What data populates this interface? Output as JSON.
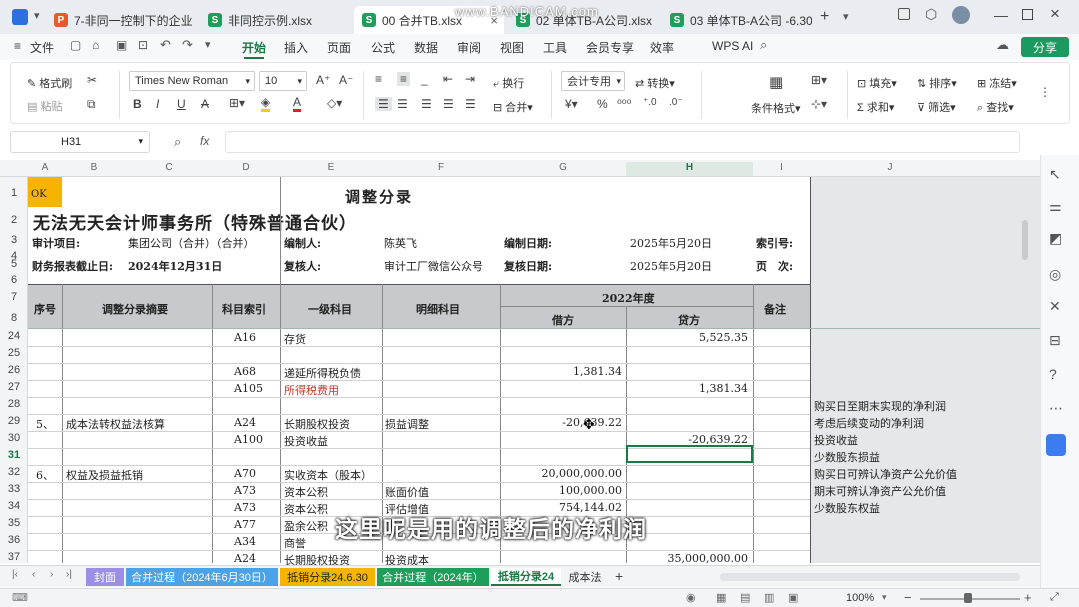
{
  "window": {
    "watermark": "www.BANDICAM.com"
  },
  "tabs": [
    {
      "label": "7-非同一控制下的企业"
    },
    {
      "label": "非同控示例.xlsx"
    },
    {
      "label": "00 合并TB.xlsx"
    },
    {
      "label": "02 单体TB-A公司.xlsx"
    },
    {
      "label": "03 单体TB-A公司 -6.30"
    }
  ],
  "menu": {
    "file": "文件",
    "items": [
      "开始",
      "插入",
      "页面",
      "公式",
      "数据",
      "审阅",
      "视图",
      "工具",
      "会员专享",
      "效率",
      "WPS AI"
    ],
    "share": "分享"
  },
  "ribbon": {
    "format_painter": "格式刷",
    "paste": "粘贴",
    "font": "Times New Roman",
    "size": "10",
    "wrap": "换行",
    "merge": "合并",
    "num_format": "会计专用",
    "convert": "转换",
    "cond_format": "条件格式",
    "fill": "填充",
    "sort": "排序",
    "freeze": "冻结",
    "sum": "求和",
    "filter": "筛选",
    "find": "查找"
  },
  "formula_bar": {
    "cell_ref": "H31",
    "fx": "fx"
  },
  "columns": [
    "A",
    "B",
    "C",
    "D",
    "E",
    "F",
    "G",
    "H",
    "I",
    "J"
  ],
  "rows": [
    "1",
    "2",
    "3",
    "4",
    "5",
    "6",
    "7",
    "8",
    "24",
    "25",
    "26",
    "27",
    "28",
    "29",
    "30",
    "31",
    "32",
    "33",
    "34",
    "35",
    "36",
    "37"
  ],
  "sheet": {
    "a1": "OK",
    "title": "调整分录",
    "firm": "无法无天会计师事务所（特殊普通合伙）",
    "audit_item_label": "审计项目:",
    "audit_item_value": "集团公司（合并）（合并）",
    "preparer_label": "编制人:",
    "preparer_value": "陈英飞",
    "prep_date_label": "编制日期:",
    "prep_date_value": "2025年5月20日",
    "index_label": "索引号:",
    "period_label": "财务报表截止日:",
    "period_value": "2024年12月31日",
    "reviewer_label": "复核人:",
    "reviewer_value": "审计工厂微信公众号",
    "review_date_label": "复核日期:",
    "review_date_value": "2025年5月20日",
    "page_label": "页　次:",
    "hdr_seq": "序号",
    "hdr_summary": "调整分录摘要",
    "hdr_index": "科目索引",
    "hdr_level1": "一级科目",
    "hdr_detail": "明细科目",
    "hdr_year": "2022年度",
    "hdr_debit": "借方",
    "hdr_credit": "贷方",
    "hdr_note": "备注"
  },
  "body_rows": [
    {
      "r": "24",
      "seq": "",
      "summary": "",
      "idx": "A16",
      "l1": "存货",
      "detail": "",
      "debit": "",
      "credit": "5,525.35"
    },
    {
      "r": "25",
      "seq": "",
      "summary": "",
      "idx": "",
      "l1": "",
      "detail": "",
      "debit": "",
      "credit": ""
    },
    {
      "r": "26",
      "seq": "",
      "summary": "",
      "idx": "A68",
      "l1": "递延所得税负债",
      "detail": "",
      "debit": "1,381.34",
      "credit": ""
    },
    {
      "r": "27",
      "seq": "",
      "summary": "",
      "idx": "A105",
      "l1": "所得税费用",
      "detail": "",
      "debit": "",
      "credit": "1,381.34"
    },
    {
      "r": "28",
      "seq": "",
      "summary": "",
      "idx": "",
      "l1": "",
      "detail": "",
      "debit": "",
      "credit": ""
    },
    {
      "r": "29",
      "seq": "5、",
      "summary": "成本法转权益法核算",
      "idx": "A24",
      "l1": "长期股权投资",
      "detail": "损益调整",
      "debit": "-20,639.22",
      "credit": ""
    },
    {
      "r": "30",
      "seq": "",
      "summary": "",
      "idx": "A100",
      "l1": "投资收益",
      "detail": "",
      "debit": "",
      "credit": "-20,639.22"
    },
    {
      "r": "31",
      "seq": "",
      "summary": "",
      "idx": "",
      "l1": "",
      "detail": "",
      "debit": "",
      "credit": ""
    },
    {
      "r": "32",
      "seq": "6、",
      "summary": "权益及损益抵销",
      "idx": "A70",
      "l1": "实收资本（股本）",
      "detail": "",
      "debit": "20,000,000.00",
      "credit": ""
    },
    {
      "r": "33",
      "seq": "",
      "summary": "",
      "idx": "A73",
      "l1": "资本公积",
      "detail": "账面价值",
      "debit": "100,000.00",
      "credit": ""
    },
    {
      "r": "34",
      "seq": "",
      "summary": "",
      "idx": "A73",
      "l1": "资本公积",
      "detail": "评估增值",
      "debit": "754,144.02",
      "credit": ""
    },
    {
      "r": "35",
      "seq": "",
      "summary": "",
      "idx": "A77",
      "l1": "盈余公积",
      "detail": "",
      "debit": "",
      "credit": ""
    },
    {
      "r": "36",
      "seq": "",
      "summary": "",
      "idx": "A34",
      "l1": "商誉",
      "detail": "",
      "debit": "",
      "credit": ""
    },
    {
      "r": "37",
      "seq": "",
      "summary": "",
      "idx": "A24",
      "l1": "长期股权投资",
      "detail": "投资成本",
      "debit": "",
      "credit": "35,000,000.00"
    }
  ],
  "side_notes": {
    "r28": "购买日至期末实现的净利润",
    "r29": "考虑后续变动的净利润",
    "r30": "投资收益",
    "r31": "少数股东损益",
    "r32": "购买日可辨认净资产公允价值",
    "r33": "期末可辨认净资产公允价值",
    "r34": "少数股东权益"
  },
  "subtitle": "这里呢是用的调整后的净利润",
  "sheet_tabs": [
    {
      "label": "封面",
      "color": "#9b8ee6"
    },
    {
      "label": "合并过程（2024年6月30日）",
      "color": "#4aa3e8"
    },
    {
      "label": "抵销分录24.6.30",
      "color": "#f5b400"
    },
    {
      "label": "合并过程（2024年）",
      "color": "#1e9e5a"
    },
    {
      "label": "抵销分录24",
      "color": "#ffffff"
    },
    {
      "label": "成本法",
      "color": "#f3f4f6"
    }
  ],
  "status": {
    "zoom": "100%"
  }
}
